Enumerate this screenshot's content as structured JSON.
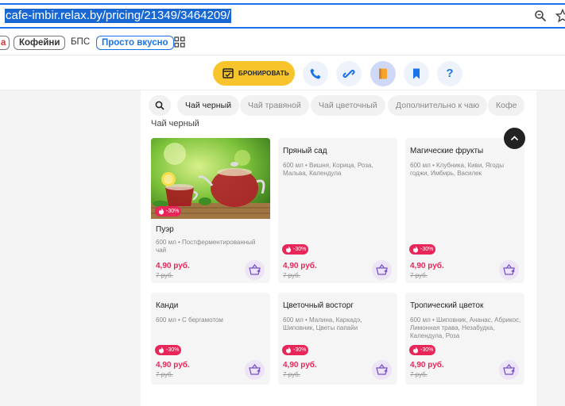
{
  "browser": {
    "url": "cafe-imbir.relax.by/pricing/21349/3464209/",
    "bookmarks": [
      "a",
      "Кофейни",
      "БПС",
      "Просто вкусно"
    ]
  },
  "header": {
    "book_label": "БРОНИРОВАТЬ",
    "help_label": "?"
  },
  "tabs": [
    "Чай черный",
    "Чай травяной",
    "Чай цветочный",
    "Дополнительно к чаю",
    "Кофе"
  ],
  "section_title": "Чай черный",
  "cards": [
    {
      "name": "Пуэр",
      "desc": "600 мл • Постферментированный чай",
      "badge": "-30%",
      "price": "4,90 руб.",
      "old_price": "7 руб."
    },
    {
      "name": "Пряный сад",
      "desc": "600 мл • Вишня, Корица, Роза, Мальва, Календула",
      "badge": "-30%",
      "price": "4,90 руб.",
      "old_price": "7 руб."
    },
    {
      "name": "Магические фрукты",
      "desc": "600 мл • Клубника, Киви, Ягоды годжи, Имбирь, Василек",
      "badge": "-30%",
      "price": "4,90 руб.",
      "old_price": "7 руб."
    },
    {
      "name": "Канди",
      "desc": "600 мл • С бергамотом",
      "badge": "-30%",
      "price": "4,90 руб.",
      "old_price": "7 руб."
    },
    {
      "name": "Цветочный восторг",
      "desc": "600 мл • Малина, Каркадэ, Шиповник, Цветы папайи",
      "badge": "-30%",
      "price": "4,90 руб.",
      "old_price": "7 руб."
    },
    {
      "name": "Тропический цветок",
      "desc": "600 мл • Шиповник, Ананас, Абрикос, Лимонная трава, Незабудка, Календула, Роза",
      "badge": "-30%",
      "price": "4,90 руб.",
      "old_price": "7 руб."
    }
  ],
  "colors": {
    "accent_yellow": "#f7c52b",
    "sale_red": "#e8265a",
    "link_blue": "#1a73e8"
  }
}
